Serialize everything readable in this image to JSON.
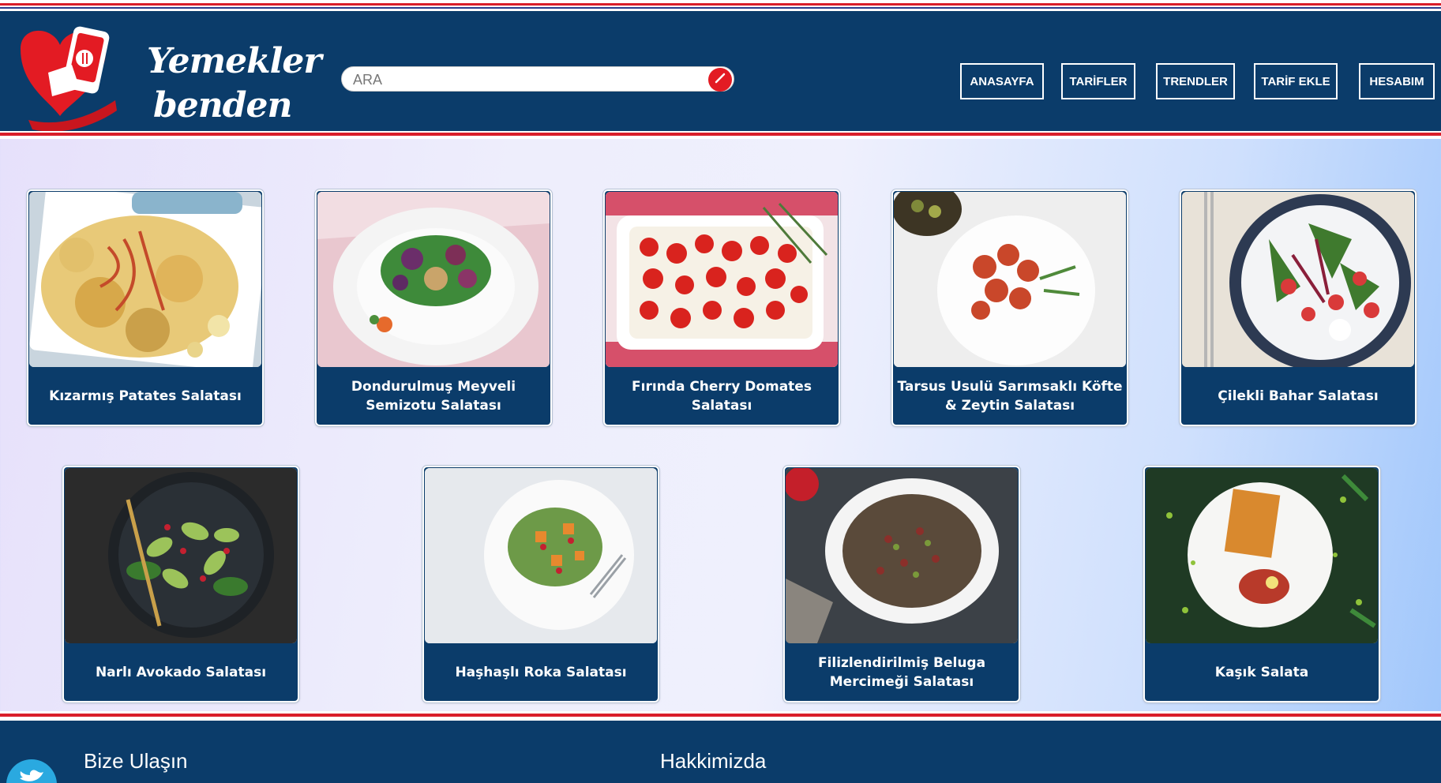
{
  "brand": {
    "line1": "Yemekler",
    "line2": "benden",
    "logo_icon": "phone-food-heart-icon",
    "colors": {
      "navy": "#0b3c6a",
      "red": "#d91e2a"
    }
  },
  "search": {
    "placeholder": "ARA",
    "value": "",
    "icon": "search-icon"
  },
  "nav": [
    {
      "label": "ANASAYFA"
    },
    {
      "label": "TARİFLER"
    },
    {
      "label": "TRENDLER"
    },
    {
      "label": "TARİF EKLE"
    },
    {
      "label": "HESABIM"
    }
  ],
  "recipes": [
    {
      "title": "Kızarmış Patates Salatası"
    },
    {
      "title": "Dondurulmuş Meyveli Semizotu Salatası"
    },
    {
      "title": "Fırında Cherry Domates Salatası"
    },
    {
      "title": "Tarsus Usulü Sarımsaklı Köfte & Zeytin Salatası"
    },
    {
      "title": "Çilekli Bahar Salatası"
    },
    {
      "title": "Narlı Avokado Salatası"
    },
    {
      "title": "Haşhaşlı Roka Salatası"
    },
    {
      "title": "Filizlendirilmiş Beluga Mercimeği Salatası"
    },
    {
      "title": "Kaşık Salata"
    }
  ],
  "footer": {
    "contact_heading": "Bize Ulaşın",
    "about_heading": "Hakkimizda",
    "social_icon": "twitter-icon"
  }
}
